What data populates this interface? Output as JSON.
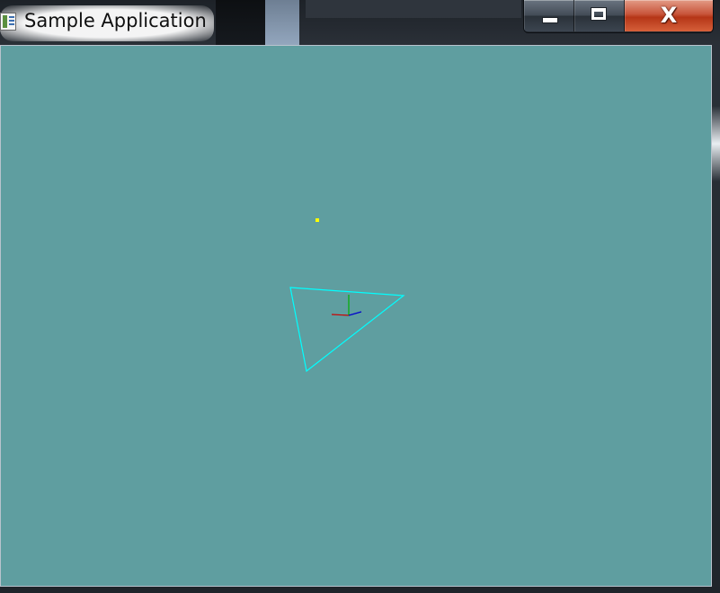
{
  "window": {
    "title": "Sample Application",
    "buttons": {
      "minimize": "minimize",
      "maximize": "maximize",
      "close": "X"
    }
  },
  "viewport": {
    "background_color": "#5f9ea0",
    "point": {
      "color": "#ffff00"
    },
    "triangle": {
      "stroke_color": "#00ffff"
    },
    "axes": {
      "x_color": "#cc0000",
      "y_color": "#00b000",
      "z_color": "#0000cc"
    }
  }
}
